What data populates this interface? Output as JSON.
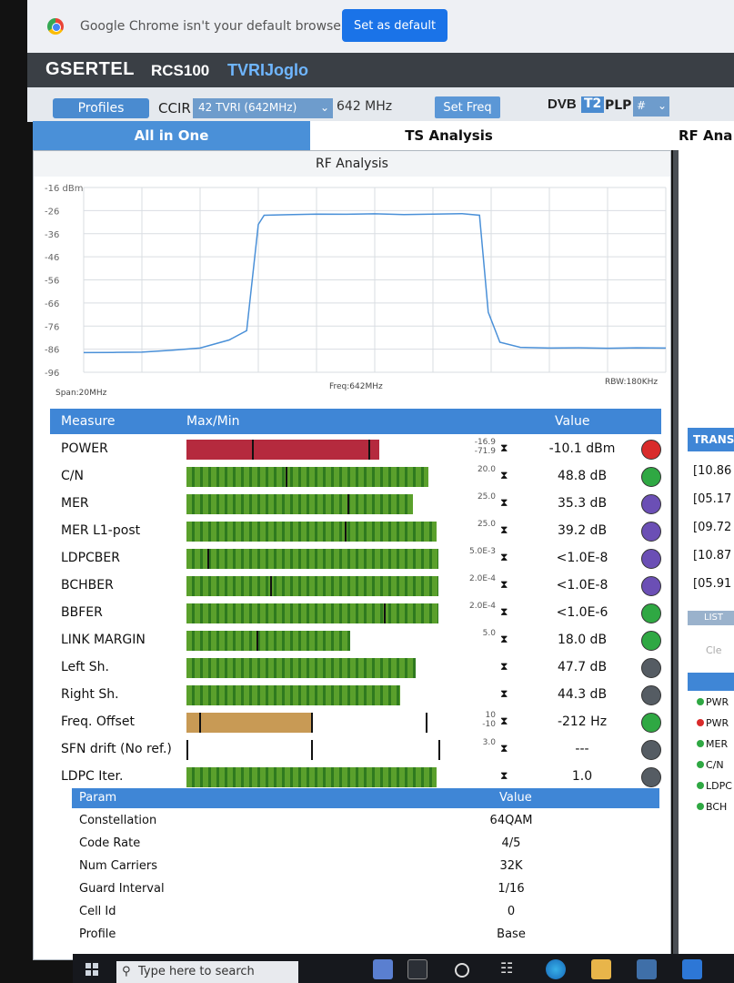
{
  "browser": {
    "notice": "Google Chrome isn't your default browser",
    "default_button": "Set as default"
  },
  "header": {
    "brand": "GSERTEL",
    "model": "RCS100",
    "station": "TVRIJoglo"
  },
  "controls": {
    "profiles_label": "Profiles",
    "ccir_label": "CCIR",
    "channel_value": "42 TVRI (642MHz)",
    "frequency": "642 MHz",
    "set_freq_label": "Set Freq",
    "dvb_logo": "DVB",
    "t2_badge": "T2",
    "plp_label": "PLP",
    "plp_value": "#"
  },
  "tabs": [
    {
      "label": "All in One",
      "active": true
    },
    {
      "label": "TS Analysis",
      "active": false
    },
    {
      "label": "RF Ana",
      "active": false
    }
  ],
  "rf_analysis": {
    "title": "RF Analysis",
    "span_label": "Span:20MHz",
    "freq_label": "Freq:642MHz",
    "rbw_label": "RBW:180KHz"
  },
  "chart_data": {
    "type": "line",
    "ylabel": "dBm",
    "y_ticks": [
      "-16 dBm",
      "-26",
      "-36",
      "-46",
      "-56",
      "-66",
      "-76",
      "-86",
      "-96"
    ],
    "ylim": [
      -96,
      -16
    ],
    "xlim": [
      632,
      652
    ],
    "x_unit": "MHz",
    "grid": true,
    "series": [
      {
        "color": "#4a90d8",
        "x": [
          632,
          633,
          634,
          635,
          636,
          637,
          637.6,
          638,
          638.2,
          639,
          640,
          641,
          642,
          643,
          644,
          645,
          645.6,
          645.9,
          646.3,
          647,
          648,
          649,
          650,
          651,
          652
        ],
        "y": [
          -87.5,
          -87.4,
          -87.3,
          -86.5,
          -85.5,
          -82,
          -78,
          -32,
          -28,
          -27.8,
          -27.5,
          -27.6,
          -27.4,
          -27.7,
          -27.5,
          -27.3,
          -28,
          -70,
          -83,
          -85.2,
          -85.5,
          -85.4,
          -85.6,
          -85.4,
          -85.5
        ]
      }
    ]
  },
  "measure_table": {
    "headers": {
      "measure": "Measure",
      "maxmin": "Max/Min",
      "value": "Value"
    },
    "rows": [
      {
        "name": "POWER",
        "fill": 0.74,
        "marks": [
          0.25,
          0.7
        ],
        "color": "red",
        "thresh_top": "-16.9",
        "thresh_bot": "-71.9",
        "value": "-10.1 dBm",
        "led": "#d92b2b"
      },
      {
        "name": "C/N",
        "fill": 0.93,
        "marks": [
          0.38
        ],
        "color": "green",
        "thresh_top": "20.0",
        "thresh_bot": "",
        "value": "48.8 dB",
        "led": "#2fa843"
      },
      {
        "name": "MER",
        "fill": 0.87,
        "marks": [
          0.62
        ],
        "color": "green",
        "thresh_top": "25.0",
        "thresh_bot": "",
        "value": "35.3 dB",
        "led": "#6b4fb5"
      },
      {
        "name": "MER L1-post",
        "fill": 0.96,
        "marks": [
          0.61
        ],
        "color": "green",
        "thresh_top": "25.0",
        "thresh_bot": "",
        "value": "39.2 dB",
        "led": "#6b4fb5"
      },
      {
        "name": "LDPCBER",
        "fill": 0.97,
        "marks": [
          0.08
        ],
        "color": "green",
        "thresh_top": "5.0E-3",
        "thresh_bot": "",
        "value": "<1.0E-8",
        "led": "#6b4fb5"
      },
      {
        "name": "BCHBER",
        "fill": 0.97,
        "marks": [
          0.32
        ],
        "color": "green",
        "thresh_top": "2.0E-4",
        "thresh_bot": "",
        "value": "<1.0E-8",
        "led": "#6b4fb5"
      },
      {
        "name": "BBFER",
        "fill": 0.97,
        "marks": [
          0.76
        ],
        "color": "green",
        "thresh_top": "2.0E-4",
        "thresh_bot": "",
        "value": "<1.0E-6",
        "led": "#2fa843"
      },
      {
        "name": "LINK MARGIN",
        "fill": 0.63,
        "marks": [
          0.27
        ],
        "color": "green",
        "thresh_top": "5.0",
        "thresh_bot": "",
        "value": "18.0 dB",
        "led": "#2fa843"
      },
      {
        "name": "Left Sh.",
        "fill": 0.88,
        "marks": [],
        "color": "green",
        "thresh_top": "",
        "thresh_bot": "",
        "value": "47.7 dB",
        "led": "#555c63"
      },
      {
        "name": "Right Sh.",
        "fill": 0.82,
        "marks": [],
        "color": "green",
        "thresh_top": "",
        "thresh_bot": "",
        "value": "44.3 dB",
        "led": "#555c63"
      },
      {
        "name": "Freq. Offset",
        "fill": 0.48,
        "marks": [
          0.05,
          0.48,
          0.92
        ],
        "color": "orange",
        "thresh_top": "10",
        "thresh_bot": "-10",
        "value": "-212 Hz",
        "led": "#2fa843"
      },
      {
        "name": "SFN drift (No ref.)",
        "fill": 0,
        "marks": [
          0.0,
          0.48,
          0.97
        ],
        "color": "green",
        "thresh_top": "3.0",
        "thresh_bot": "",
        "value": "---",
        "led": "#555c63"
      },
      {
        "name": "LDPC Iter.",
        "fill": 0.96,
        "marks": [],
        "color": "green",
        "thresh_top": "",
        "thresh_bot": "",
        "value": "1.0",
        "led": "#555c63"
      }
    ]
  },
  "param_table": {
    "headers": {
      "param": "Param",
      "value": "Value"
    },
    "rows": [
      {
        "name": "Constellation",
        "value": "64QAM"
      },
      {
        "name": "Code Rate",
        "value": "4/5"
      },
      {
        "name": "Num Carriers",
        "value": "32K"
      },
      {
        "name": "Guard Interval",
        "value": "1/16"
      },
      {
        "name": "Cell Id",
        "value": "0"
      },
      {
        "name": "Profile",
        "value": "Base"
      }
    ]
  },
  "right_panel": {
    "trans_title": "TRANS",
    "trans_items": [
      "[10.86",
      "[05.17",
      "[09.72",
      "[10.87",
      "[05.91"
    ],
    "list_label": "LIST",
    "clear_label": "Cle",
    "legend": [
      {
        "label": "PWR",
        "color": "#2fa843"
      },
      {
        "label": "PWR",
        "color": "#d92b2b"
      },
      {
        "label": "MER",
        "color": "#2fa843"
      },
      {
        "label": "C/N",
        "color": "#2fa843"
      },
      {
        "label": "LDPC",
        "color": "#2fa843"
      },
      {
        "label": "BCH",
        "color": "#2fa843"
      }
    ]
  },
  "taskbar": {
    "search_placeholder": "Type here to search"
  }
}
